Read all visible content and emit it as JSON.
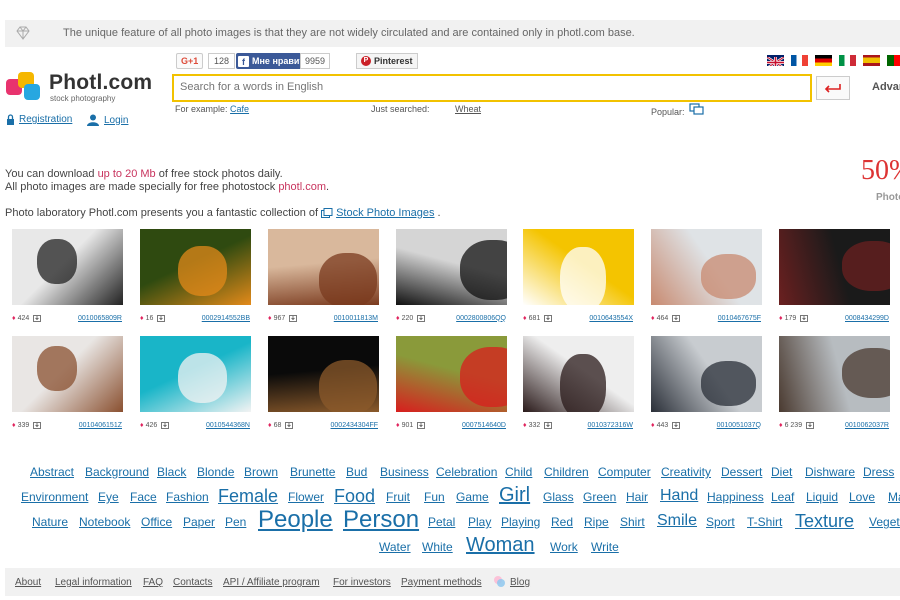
{
  "topbar": {
    "message": "The unique feature of all photo images is that they are not widely circulated and are contained only in photl.com base."
  },
  "logo": {
    "title": "Photl.com",
    "subtitle": "stock photography"
  },
  "user": {
    "registration": "Registration",
    "login": "Login"
  },
  "social": {
    "gplus": "G+1",
    "gplus_count": "128",
    "fb_label": "Мне нравится",
    "fb_count": "9959",
    "pinterest": "Pinterest"
  },
  "search": {
    "placeholder": "Search for a words in English",
    "advanced": "Advanced"
  },
  "hints": {
    "example_label": "For example:",
    "example_value": "Cafe",
    "just_label": "Just searched:",
    "just_value": "Wheat",
    "popular_label": "Popular:"
  },
  "info": {
    "line1_pre": "You can download ",
    "line1_highlight": "up to 20 Mb",
    "line1_post": " of free stock photos daily.",
    "line2_pre": "All photo images are made specially for free photostock ",
    "line2_highlight": "photl.com",
    "line2_post": "."
  },
  "collection": {
    "text": "Photo laboratory Photl.com presents you a fantastic collection of",
    "link": "Stock Photo Images",
    "end": "."
  },
  "promo": {
    "big": "50%",
    "small": "Photo"
  },
  "photos_row1": [
    {
      "count": "424",
      "code": "0010065809R",
      "c1": "#e8e8e8",
      "c2": "#222"
    },
    {
      "count": "16",
      "code": "0002914552BB",
      "c1": "#2f4a10",
      "c2": "#e38a1a"
    },
    {
      "count": "967",
      "code": "0010011813M",
      "c1": "#d9b89c",
      "c2": "#7a3a1e"
    },
    {
      "count": "220",
      "code": "0002800806QQ",
      "c1": "#d5d5d5",
      "c2": "#111"
    },
    {
      "count": "681",
      "code": "0010643554X",
      "c1": "#f4c400",
      "c2": "#ffffff"
    },
    {
      "count": "464",
      "code": "0010467675F",
      "c1": "#dfe3e6",
      "c2": "#c88a70"
    },
    {
      "count": "179",
      "code": "0008434299D",
      "c1": "#1a1a1a",
      "c2": "#6b2020"
    }
  ],
  "photos_row2": [
    {
      "count": "339",
      "code": "0010406151Z",
      "c1": "#e9e6e4",
      "c2": "#8a5030"
    },
    {
      "count": "426",
      "code": "0010544368N",
      "c1": "#19b5c8",
      "c2": "#f3f3f3"
    },
    {
      "count": "68",
      "code": "0002434304FF",
      "c1": "#0a0a0a",
      "c2": "#8b5a2b"
    },
    {
      "count": "901",
      "code": "0007514640D",
      "c1": "#8a9a3a",
      "c2": "#d81e1e"
    },
    {
      "count": "332",
      "code": "0010372316W",
      "c1": "#eeeeee",
      "c2": "#2a1a1a"
    },
    {
      "count": "443",
      "code": "0010051037Q",
      "c1": "#c8ccd0",
      "c2": "#2a2f38"
    },
    {
      "count": "6 239",
      "code": "0010062037R",
      "c1": "#b7bcc0",
      "c2": "#4a3a30"
    }
  ],
  "tags_row1": [
    "Abstract",
    "Background",
    "Black",
    "Blonde",
    "Brown",
    "Brunette",
    "Bud",
    "Business",
    "Celebration",
    "Child",
    "Children",
    "Computer",
    "Creativity",
    "Dessert",
    "Diet",
    "Dishware",
    "Dress"
  ],
  "tags_row2": [
    "Environment",
    "Eye",
    "Face",
    "Fashion",
    "Female",
    "Flower",
    "Food",
    "Fruit",
    "Fun",
    "Game",
    "Girl",
    "Glass",
    "Green",
    "Hair",
    "Hand",
    "Happiness",
    "Leaf",
    "Liquid",
    "Love",
    "Ma"
  ],
  "tags_row3": [
    "Nature",
    "Notebook",
    "Office",
    "Paper",
    "Pen",
    "People",
    "Person",
    "Petal",
    "Play",
    "Playing",
    "Red",
    "Ripe",
    "Shirt",
    "Smile",
    "Sport",
    "T-Shirt",
    "Texture",
    "Vegeta"
  ],
  "tags_row4": [
    "Water",
    "White",
    "Woman",
    "Work",
    "Write"
  ],
  "footer": [
    "About",
    "Legal information",
    "FAQ",
    "Contacts",
    "API / Affiliate program",
    "For investors",
    "Payment methods",
    "Blog"
  ]
}
